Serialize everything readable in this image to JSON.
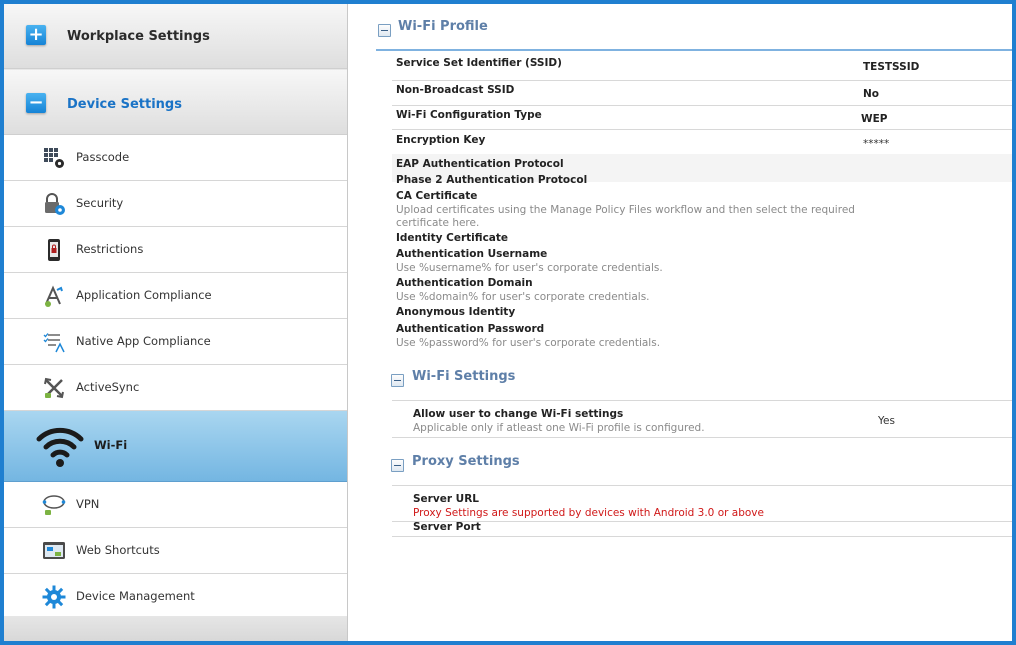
{
  "sidebar": {
    "sections": [
      {
        "label": "Workplace Settings",
        "toggle": "+"
      },
      {
        "label": "Device Settings",
        "toggle": "−"
      }
    ],
    "items": [
      {
        "label": "Passcode",
        "icon": "keypad-gear-icon"
      },
      {
        "label": "Security",
        "icon": "lock-gear-icon"
      },
      {
        "label": "Restrictions",
        "icon": "phone-lock-icon"
      },
      {
        "label": "Application Compliance",
        "icon": "app-compliance-icon"
      },
      {
        "label": "Native App Compliance",
        "icon": "checklist-app-icon"
      },
      {
        "label": "ActiveSync",
        "icon": "activesync-icon"
      },
      {
        "label": "Wi-Fi",
        "icon": "wifi-icon",
        "active": true
      },
      {
        "label": "VPN",
        "icon": "vpn-icon"
      },
      {
        "label": "Web Shortcuts",
        "icon": "web-shortcut-icon"
      },
      {
        "label": "Device Management",
        "icon": "gear-icon"
      }
    ]
  },
  "wifi_profile": {
    "title": "Wi-Fi Profile",
    "rows": [
      {
        "label": "Service Set Identifier (SSID)",
        "value": "TESTSSID"
      },
      {
        "label": "Non-Broadcast SSID",
        "value": "No"
      },
      {
        "label": "Wi-Fi Configuration Type",
        "value": "WEP"
      },
      {
        "label": "Encryption Key",
        "value": "*****"
      },
      {
        "label": "EAP Authentication Protocol"
      },
      {
        "label": "Phase 2 Authentication Protocol"
      },
      {
        "label": "CA Certificate",
        "hint": "Upload certificates using the Manage Policy Files workflow and then select the required certificate here."
      },
      {
        "label": "Identity Certificate"
      },
      {
        "label": "Authentication Username",
        "hint": "Use %username% for user's corporate credentials."
      },
      {
        "label": "Authentication Domain",
        "hint": "Use %domain% for user's corporate credentials."
      },
      {
        "label": "Anonymous Identity"
      },
      {
        "label": "Authentication Password",
        "hint": "Use %password% for user's corporate credentials."
      }
    ]
  },
  "wifi_settings": {
    "title": "Wi-Fi Settings",
    "label": "Allow user to change Wi-Fi settings",
    "hint": "Applicable only if atleast one Wi-Fi profile is configured.",
    "value": "Yes"
  },
  "proxy_settings": {
    "title": "Proxy Settings",
    "server_url_label": "Server URL",
    "server_url_hint": "Proxy Settings are supported by devices with Android 3.0 or above",
    "server_port_label": "Server Port"
  },
  "colors": {
    "accent": "#1a73c6",
    "frame": "#1f7fd0",
    "warning": "#d01818"
  }
}
